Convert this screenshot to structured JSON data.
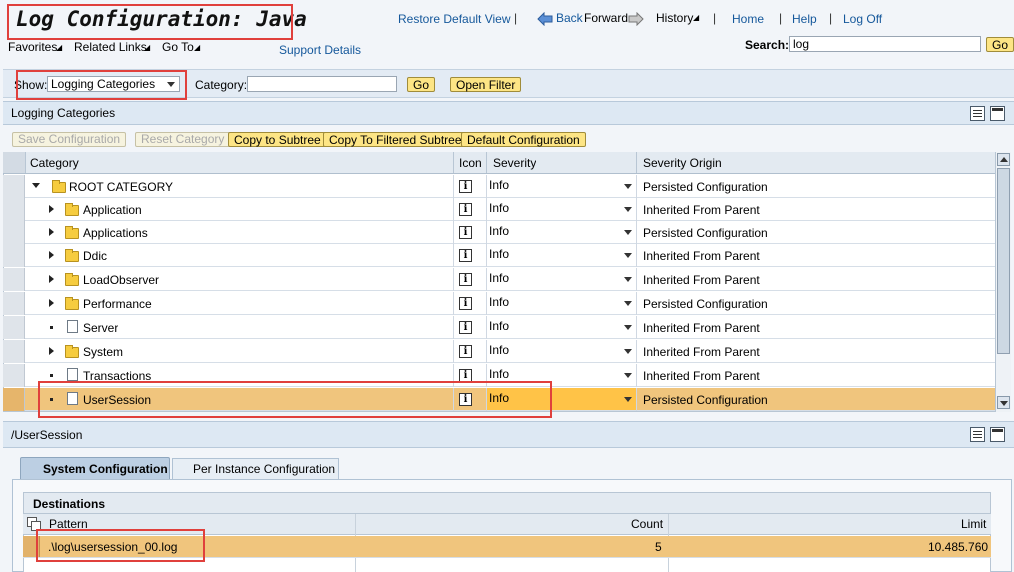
{
  "page": {
    "title": "Log Configuration: Java"
  },
  "topnav": {
    "restore": "Restore Default View",
    "back": "Back",
    "forward": "Forward",
    "history": "History",
    "home": "Home",
    "help": "Help",
    "logoff": "Log Off"
  },
  "menubar": {
    "favorites": "Favorites",
    "related": "Related Links",
    "goto": "Go To",
    "support": "Support Details"
  },
  "search": {
    "label": "Search:",
    "value": "log",
    "go": "Go"
  },
  "filter": {
    "show_label": "Show:",
    "show_value": "Logging Categories",
    "category_label": "Category:",
    "category_value": "",
    "go": "Go",
    "open_filter": "Open Filter"
  },
  "panel1": {
    "title": "Logging Categories"
  },
  "toolbar": {
    "save": "Save Configuration",
    "reset": "Reset Category",
    "copy_subtree": "Copy to Subtree",
    "copy_filtered": "Copy To Filtered Subtree",
    "default": "Default Configuration"
  },
  "table": {
    "headers": {
      "category": "Category",
      "icon": "Icon",
      "severity": "Severity",
      "origin": "Severity Origin"
    },
    "rows": [
      {
        "name": "ROOT CATEGORY",
        "severity": "Info",
        "origin": "Persisted Configuration"
      },
      {
        "name": "Application",
        "severity": "Info",
        "origin": "Inherited From Parent"
      },
      {
        "name": "Applications",
        "severity": "Info",
        "origin": "Persisted Configuration"
      },
      {
        "name": "Ddic",
        "severity": "Info",
        "origin": "Inherited From Parent"
      },
      {
        "name": "LoadObserver",
        "severity": "Info",
        "origin": "Inherited From Parent"
      },
      {
        "name": "Performance",
        "severity": "Info",
        "origin": "Persisted Configuration"
      },
      {
        "name": "Server",
        "severity": "Info",
        "origin": "Inherited From Parent"
      },
      {
        "name": "System",
        "severity": "Info",
        "origin": "Inherited From Parent"
      },
      {
        "name": "Transactions",
        "severity": "Info",
        "origin": "Inherited From Parent"
      },
      {
        "name": "UserSession",
        "severity": "Info",
        "origin": "Persisted Configuration"
      }
    ]
  },
  "panel2": {
    "title": "/UserSession"
  },
  "tabs": {
    "system": "System Configuration",
    "instance": "Per Instance Configuration"
  },
  "destinations": {
    "title": "Destinations",
    "headers": {
      "pattern": "Pattern",
      "count": "Count",
      "limit": "Limit"
    },
    "row": {
      "pattern": ".\\log\\usersession_00.log",
      "count": "5",
      "limit": "10.485.760"
    }
  }
}
